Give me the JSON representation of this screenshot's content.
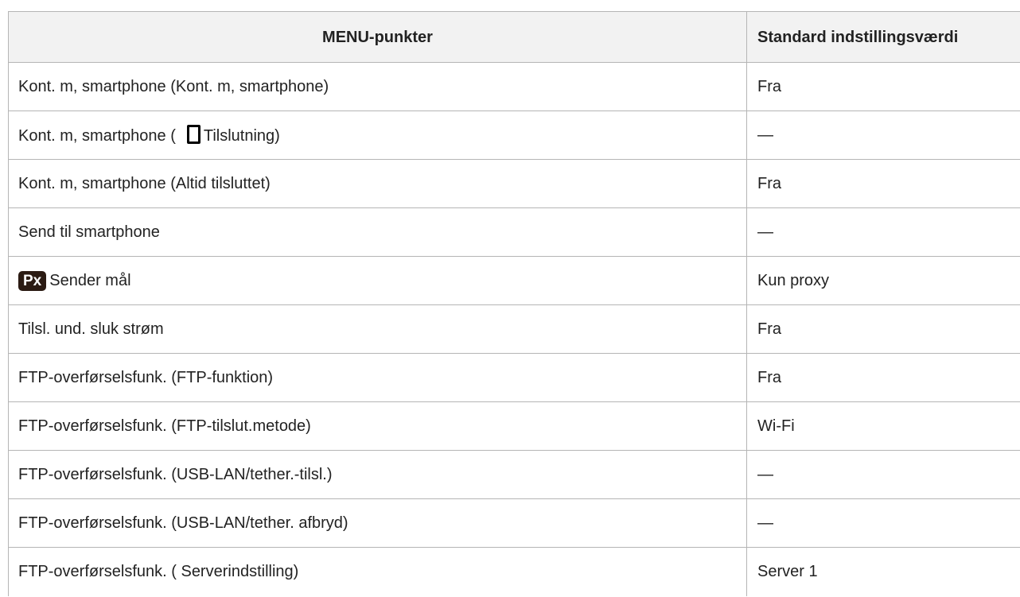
{
  "colors": {
    "header_bg": "#f2f2f2",
    "border": "#b5b5b5",
    "text": "#222222",
    "px_badge_bg": "#2b1b13"
  },
  "table": {
    "headers": {
      "item": "MENU-punkter",
      "value": "Standard indstillingsværdi"
    },
    "rows": [
      {
        "item": "Kont. m, smartphone (Kont. m, smartphone)",
        "value": "Fra"
      },
      {
        "item_prefix": "Kont. m, smartphone (",
        "icon": "smartphone-icon",
        "item_suffix": "Tilslutning)",
        "value": "—"
      },
      {
        "item": "Kont. m, smartphone (Altid tilsluttet)",
        "value": "Fra"
      },
      {
        "item": "Send til smartphone",
        "value": "—"
      },
      {
        "icon": "px-badge-icon",
        "icon_text": "Px",
        "item_suffix": "Sender mål",
        "value": "Kun proxy"
      },
      {
        "item": "Tilsl. und. sluk strøm",
        "value": "Fra"
      },
      {
        "item": "FTP-overførselsfunk. (FTP-funktion)",
        "value": "Fra"
      },
      {
        "item": "FTP-overførselsfunk. (FTP-tilslut.metode)",
        "value": "Wi-Fi"
      },
      {
        "item": "FTP-overførselsfunk. (USB-LAN/tether.-tilsl.)",
        "value": "—"
      },
      {
        "item": "FTP-overførselsfunk. (USB-LAN/tether. afbryd)",
        "value": "—"
      },
      {
        "item": "FTP-overførselsfunk. ( Serverindstilling)",
        "value": "Server 1"
      }
    ]
  }
}
